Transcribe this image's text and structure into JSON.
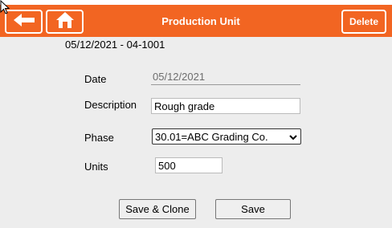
{
  "header": {
    "title": "Production Unit",
    "back_icon": "arrow-left-icon",
    "home_icon": "home-icon",
    "delete_label": "Delete",
    "accent_color": "#f26522"
  },
  "record": {
    "summary": "05/12/2021 - 04-1001"
  },
  "form": {
    "date_label": "Date",
    "date_value": "05/12/2021",
    "description_label": "Description",
    "description_value": "Rough grade",
    "phase_label": "Phase",
    "phase_value": "30.01=ABC Grading Co.",
    "units_label": "Units",
    "units_value": "500"
  },
  "actions": {
    "save_clone_label": "Save & Clone",
    "save_label": "Save"
  }
}
